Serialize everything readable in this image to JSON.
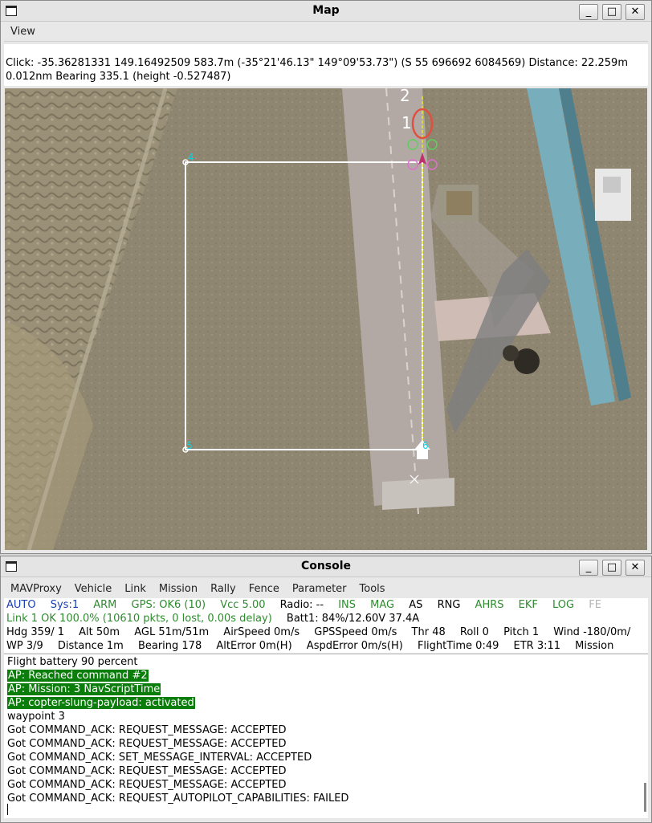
{
  "map_window": {
    "title": "Map",
    "menu": [
      "View"
    ],
    "click_info": {
      "line1": "Click: -35.36281331 149.16492509  583.7m (-35°21'46.13\" 149°09'53.73\") (S 55 696692 6084569)  Distance: 22.259m",
      "line2": "0.012nm Bearing 335.1 (height -0.527487)"
    },
    "waypoint_labels": [
      "2",
      "1",
      "4",
      "5",
      "6"
    ],
    "colors": {
      "fence": "#ffffff",
      "waypoint_label": "#00d8e8",
      "home_circle": "#e05040",
      "flight_path": "#e8e820"
    }
  },
  "console_window": {
    "title": "Console",
    "menu": [
      "MAVProxy",
      "Vehicle",
      "Link",
      "Mission",
      "Rally",
      "Fence",
      "Parameter",
      "Tools"
    ],
    "status_row1": [
      "AUTO",
      "Sys:1",
      "ARM",
      "GPS: OK6 (10)",
      "Vcc 5.00",
      "Radio: --",
      "INS",
      "MAG",
      "AS",
      "RNG",
      "AHRS",
      "EKF",
      "LOG",
      "FE"
    ],
    "status_row2": [
      "Link 1 OK 100.0% (10610 pkts, 0 lost, 0.00s delay)",
      "Batt1: 84%/12.60V 37.4A"
    ],
    "status_row3": [
      "Hdg 359/  1",
      "Alt 50m",
      "AGL 51m/51m",
      "AirSpeed 0m/s",
      "GPSSpeed 0m/s",
      "Thr 48",
      "Roll 0",
      "Pitch 1",
      "Wind -180/0m/"
    ],
    "status_row4": [
      "WP 3/9",
      "Distance 1m",
      "Bearing 178",
      "AltError 0m(H)",
      "AspdError 0m/s(H)",
      "FlightTime 0:49",
      "ETR 3:11",
      "Mission"
    ],
    "log": [
      "Flight battery 90 percent",
      "AP: Reached command #2",
      "AP: Mission: 3 NavScriptTime",
      "AP: copter-slung-payload: activated",
      "waypoint 3",
      "Got COMMAND_ACK: REQUEST_MESSAGE: ACCEPTED",
      "Got COMMAND_ACK: REQUEST_MESSAGE: ACCEPTED",
      "Got COMMAND_ACK: SET_MESSAGE_INTERVAL: ACCEPTED",
      "Got COMMAND_ACK: REQUEST_MESSAGE: ACCEPTED",
      "Got COMMAND_ACK: REQUEST_MESSAGE: ACCEPTED",
      "Got COMMAND_ACK: REQUEST_AUTOPILOT_CAPABILITIES: FAILED"
    ],
    "colors": {
      "highlight": "#0a7d0a",
      "ok_text": "#2e8b2e",
      "mode_text": "#1a3fb0"
    }
  },
  "window_buttons": {
    "minimize": "_",
    "maximize": "□",
    "close": "✕"
  }
}
